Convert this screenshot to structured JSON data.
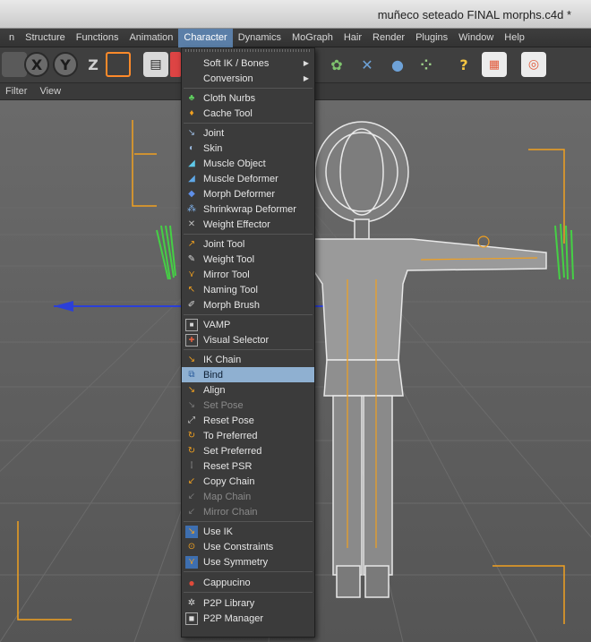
{
  "window": {
    "title": "muñeco seteado FINAL morphs.c4d *"
  },
  "menubar": {
    "items": [
      {
        "label": "n"
      },
      {
        "label": "Structure"
      },
      {
        "label": "Functions"
      },
      {
        "label": "Animation"
      },
      {
        "label": "Character"
      },
      {
        "label": "Dynamics"
      },
      {
        "label": "MoGraph"
      },
      {
        "label": "Hair"
      },
      {
        "label": "Render"
      },
      {
        "label": "Plugins"
      },
      {
        "label": "Window"
      },
      {
        "label": "Help"
      }
    ]
  },
  "toolbar": {
    "icons": [
      {
        "name": "x-axis-lock-icon",
        "glyph": "X",
        "color": "#f2c84b"
      },
      {
        "name": "y-axis-lock-icon",
        "glyph": "Y",
        "color": "#f2c84b"
      },
      {
        "name": "z-axis-lock-icon",
        "glyph": "Z",
        "color": "#cfcfcf"
      },
      {
        "name": "world-coordinates-icon",
        "glyph": "⬚",
        "color": "#ff8a2a"
      },
      {
        "name": "render-view-icon",
        "glyph": "🎬",
        "color": "#eeeeee"
      },
      {
        "name": "hidden-icon",
        "glyph": "■",
        "color": "#d44"
      },
      {
        "name": "soft-ik-icon",
        "glyph": "◆",
        "color": "#7fc46e"
      },
      {
        "name": "deformer-icon",
        "glyph": "✿",
        "color": "#7fc46e"
      },
      {
        "name": "scene-icon",
        "glyph": "✕",
        "color": "#6ea2d8"
      },
      {
        "name": "camera-icon",
        "glyph": "●",
        "color": "#6ea2d8"
      },
      {
        "name": "particles-icon",
        "glyph": "⁘",
        "color": "#9fd28a"
      },
      {
        "name": "help-cursor-icon",
        "glyph": "?",
        "color": "#f4c542"
      },
      {
        "name": "chart-tool-icon",
        "glyph": "▦",
        "color": "#e25a3a"
      },
      {
        "name": "globe-render-icon",
        "glyph": "◎",
        "color": "#e25a3a"
      }
    ]
  },
  "viewbar": {
    "items": [
      {
        "label": "Filter"
      },
      {
        "label": "View"
      }
    ]
  },
  "character_menu": {
    "items": [
      {
        "label": "Soft IK / Bones",
        "submenu": true,
        "icon": "none"
      },
      {
        "label": "Conversion",
        "submenu": true,
        "icon": "none"
      },
      {
        "label": "Cloth Nurbs",
        "icon": "cloth-nurbs-icon"
      },
      {
        "label": "Cache Tool",
        "icon": "cache-tool-icon"
      },
      {
        "label": "Joint",
        "icon": "joint-icon"
      },
      {
        "label": "Skin",
        "icon": "skin-icon"
      },
      {
        "label": "Muscle Object",
        "icon": "muscle-object-icon"
      },
      {
        "label": "Muscle Deformer",
        "icon": "muscle-deformer-icon"
      },
      {
        "label": "Morph Deformer",
        "icon": "morph-deformer-icon"
      },
      {
        "label": "Shrinkwrap Deformer",
        "icon": "shrinkwrap-deformer-icon"
      },
      {
        "label": "Weight Effector",
        "icon": "weight-effector-icon"
      },
      {
        "label": "Joint Tool",
        "icon": "joint-tool-icon"
      },
      {
        "label": "Weight Tool",
        "icon": "weight-tool-icon"
      },
      {
        "label": "Mirror Tool",
        "icon": "mirror-tool-icon"
      },
      {
        "label": "Naming Tool",
        "icon": "naming-tool-icon"
      },
      {
        "label": "Morph Brush",
        "icon": "morph-brush-icon"
      },
      {
        "label": "VAMP",
        "icon": "vamp-icon"
      },
      {
        "label": "Visual Selector",
        "icon": "visual-selector-icon"
      },
      {
        "label": "IK Chain",
        "icon": "ik-chain-icon"
      },
      {
        "label": "Bind",
        "icon": "bind-icon",
        "selected": true
      },
      {
        "label": "Align",
        "icon": "align-icon"
      },
      {
        "label": "Set Pose",
        "icon": "set-pose-icon",
        "disabled": true
      },
      {
        "label": "Reset Pose",
        "icon": "reset-pose-icon"
      },
      {
        "label": "To Preferred",
        "icon": "to-preferred-icon"
      },
      {
        "label": "Set Preferred",
        "icon": "set-preferred-icon"
      },
      {
        "label": "Reset PSR",
        "icon": "reset-psr-icon"
      },
      {
        "label": "Copy Chain",
        "icon": "copy-chain-icon"
      },
      {
        "label": "Map Chain",
        "icon": "map-chain-icon",
        "disabled": true
      },
      {
        "label": "Mirror Chain",
        "icon": "mirror-chain-icon",
        "disabled": true
      },
      {
        "label": "Use IK",
        "icon": "use-ik-icon"
      },
      {
        "label": "Use Constraints",
        "icon": "use-constraints-icon"
      },
      {
        "label": "Use Symmetry",
        "icon": "use-symmetry-icon"
      },
      {
        "label": "Cappucino",
        "icon": "cappucino-icon"
      },
      {
        "label": "P2P Library",
        "icon": "p2p-library-icon"
      },
      {
        "label": "P2P Manager",
        "icon": "p2p-manager-icon"
      }
    ]
  },
  "colors": {
    "menu_selected": "#8fb0d1",
    "menubar_active": "#5b7fa8",
    "viewport": "#5a5a5a",
    "bone_orange": "#f0a020",
    "axis_blue": "#2b3fd8"
  }
}
